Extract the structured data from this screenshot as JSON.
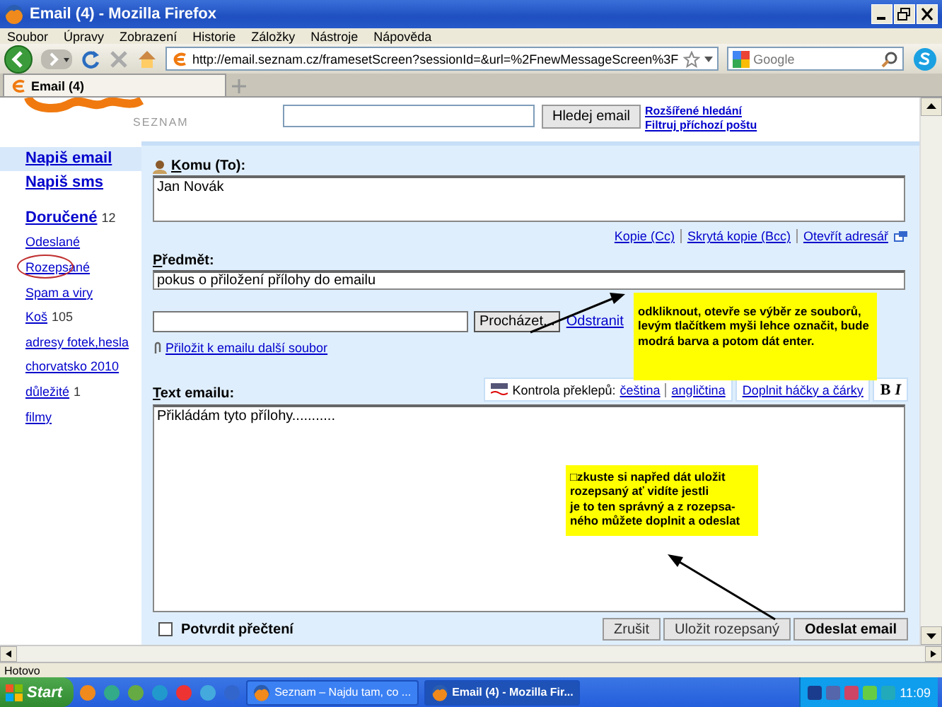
{
  "window": {
    "title": "Email (4) - Mozilla Firefox"
  },
  "menu": [
    "Soubor",
    "Úpravy",
    "Zobrazení",
    "Historie",
    "Záložky",
    "Nástroje",
    "Nápověda"
  ],
  "address_bar": {
    "value": "http://email.seznam.cz/framesetScreen?sessionId=&url=%2FnewMessageScreen%3F"
  },
  "search_box": {
    "placeholder": "Google"
  },
  "tabs": [
    {
      "label": "Email (4)",
      "selected": true
    }
  ],
  "header": {
    "logo_text": "SEZNAM",
    "search_button": "Hledej email",
    "links": [
      "Rozšířené hledání",
      "Filtruj příchozí poštu"
    ]
  },
  "sidebar": {
    "actions": [
      {
        "label": "Napiš email",
        "selected": true
      },
      {
        "label": "Napiš sms",
        "selected": false
      }
    ],
    "folders": [
      {
        "label": "Doručené",
        "count": "12",
        "bold": true,
        "circled": false
      },
      {
        "label": "Odeslané",
        "bold": false,
        "circled": false
      },
      {
        "label": "Rozepsané",
        "bold": false,
        "circled": true
      },
      {
        "label": "Spam a viry",
        "bold": false,
        "circled": false
      },
      {
        "label": "Koš",
        "count": "105",
        "bold": false,
        "circled": false
      },
      {
        "label": "adresy fotek,hesla",
        "bold": false,
        "circled": false
      },
      {
        "label": "chorvatsko 2010",
        "bold": false,
        "circled": false
      },
      {
        "label": "důležité",
        "count": "1",
        "bold": false,
        "circled": false
      },
      {
        "label": "filmy",
        "bold": false,
        "circled": false
      }
    ]
  },
  "compose": {
    "to_label": "Komu (To):",
    "to_value": "Jan Novák",
    "recipient_links": [
      "Kopie (Cc)",
      "Skrytá kopie (Bcc)",
      "Otevřít adresář"
    ],
    "subject_label": "Předmět:",
    "subject_value": "pokus o přiložení přílohy do emailu",
    "browse_button": "Procházet...",
    "remove_link": "Odstranit",
    "attach_link": "Přiložit k emailu další soubor",
    "body_label": "Text emailu:",
    "spellcheck_label": "Kontrola překlepů:",
    "spell_languages": [
      "čeština",
      "angličtina"
    ],
    "diacritics_link": "Doplnit háčky a čárky",
    "format_buttons": [
      "B",
      "I"
    ],
    "body_value": "Přikládám tyto přílohy...........",
    "read_receipt": {
      "label": "Potvrdit přečtení",
      "checked": false
    },
    "buttons": [
      {
        "label": "Zrušit",
        "primary": false
      },
      {
        "label": "Uložit rozepsaný",
        "primary": false
      },
      {
        "label": "Odeslat email",
        "primary": true
      }
    ]
  },
  "annotations": [
    {
      "lines": [
        "odkliknout, otevře se výběr ze souborů,",
        "levým tlačítkem myši lehce označit, bude",
        "modrá barva a potom dát enter."
      ]
    },
    {
      "lines": [
        "□zkuste si napřed dát uložit",
        "rozepsaný ať vidíte jestli",
        "je to ten správný a z rozepsa-",
        "ného můžete doplnit a odeslat"
      ]
    }
  ],
  "status_bar": "Hotovo",
  "taskbar": {
    "start": "Start",
    "tasks": [
      {
        "label": "Seznam – Najdu tam, co ...",
        "selected": false
      },
      {
        "label": "Email (4) - Mozilla Fir...",
        "selected": true
      }
    ],
    "clock": "11:09"
  }
}
